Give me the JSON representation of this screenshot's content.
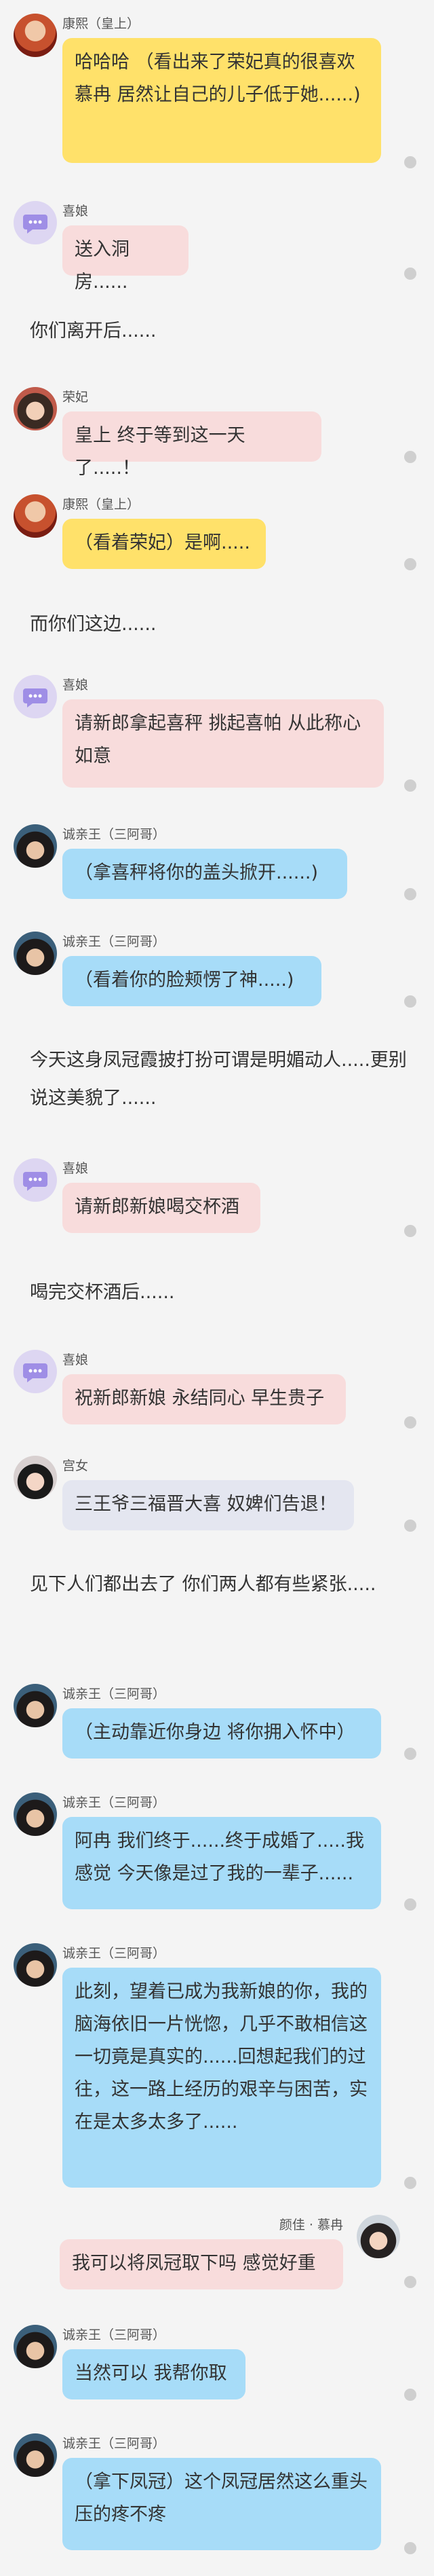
{
  "chat": {
    "m1": {
      "name": "康熙（皇上）",
      "avatar": "emperor-avatar",
      "text": "哈哈哈 （看出来了荣妃真的很喜欢慕冉 居然让自己的儿子低于她......)"
    },
    "m2": {
      "name": "喜娘",
      "avatar": "chat-bubble-avatar",
      "text": "送入洞房......"
    },
    "n1": "你们离开后......",
    "m3": {
      "name": "荣妃",
      "avatar": "consort-avatar",
      "text": "皇上 终于等到这一天了.....！"
    },
    "m4": {
      "name": "康熙（皇上）",
      "avatar": "emperor-avatar",
      "text": "（看着荣妃）是啊....."
    },
    "n2": "而你们这边......",
    "m5": {
      "name": "喜娘",
      "avatar": "chat-bubble-avatar",
      "text": "请新郎拿起喜秤 挑起喜帕 从此称心如意"
    },
    "m6": {
      "name": "诚亲王（三阿哥）",
      "avatar": "prince-avatar",
      "text": "（拿喜秤将你的盖头掀开......)"
    },
    "m7": {
      "name": "诚亲王（三阿哥）",
      "avatar": "prince-avatar",
      "text": "（看着你的脸颊愣了神.....)"
    },
    "n3": "今天这身凤冠霞披打扮可谓是明媚动人.....更别说这美貌了......",
    "m8": {
      "name": "喜娘",
      "avatar": "chat-bubble-avatar",
      "text": "请新郎新娘喝交杯酒"
    },
    "n4": "喝完交杯酒后......",
    "m9": {
      "name": "喜娘",
      "avatar": "chat-bubble-avatar",
      "text": "祝新郎新娘 永结同心 早生贵子"
    },
    "m10": {
      "name": "宫女",
      "avatar": "maid-avatar",
      "text": "三王爷三福晋大喜 奴婢们告退！"
    },
    "n5": "见下人们都出去了 你们两人都有些紧张.....",
    "m11": {
      "name": "诚亲王（三阿哥）",
      "avatar": "prince-avatar",
      "text": "（主动靠近你身边 将你拥入怀中）"
    },
    "m12": {
      "name": "诚亲王（三阿哥）",
      "avatar": "prince-avatar",
      "text": "阿冉 我们终于......终于成婚了.....我感觉 今天像是过了我的一辈子......"
    },
    "m13": {
      "name": "诚亲王（三阿哥）",
      "avatar": "prince-avatar",
      "text": "此刻，望着已成为我新娘的你，我的脑海依旧一片恍惚，几乎不敢相信这一切竟是真实的......回想起我们的过往，这一路上经历的艰辛与困苦，实在是太多太多了......"
    },
    "m14": {
      "name": "颜佳 · 慕冉",
      "avatar": "bride-avatar",
      "text": "我可以将凤冠取下吗 感觉好重"
    },
    "m15": {
      "name": "诚亲王（三阿哥）",
      "avatar": "prince-avatar",
      "text": "当然可以 我帮你取"
    },
    "m16": {
      "name": "诚亲王（三阿哥）",
      "avatar": "prince-avatar",
      "text": "（拿下凤冠）这个凤冠居然这么重头压的疼不疼"
    }
  },
  "colors": {
    "yellow_bubble": "#ffe16a",
    "pink_bubble": "#f8dcdc",
    "blue_bubble": "#a7dcf8",
    "gray_bubble": "#e4e6f0",
    "background": "#f4f4f4"
  }
}
